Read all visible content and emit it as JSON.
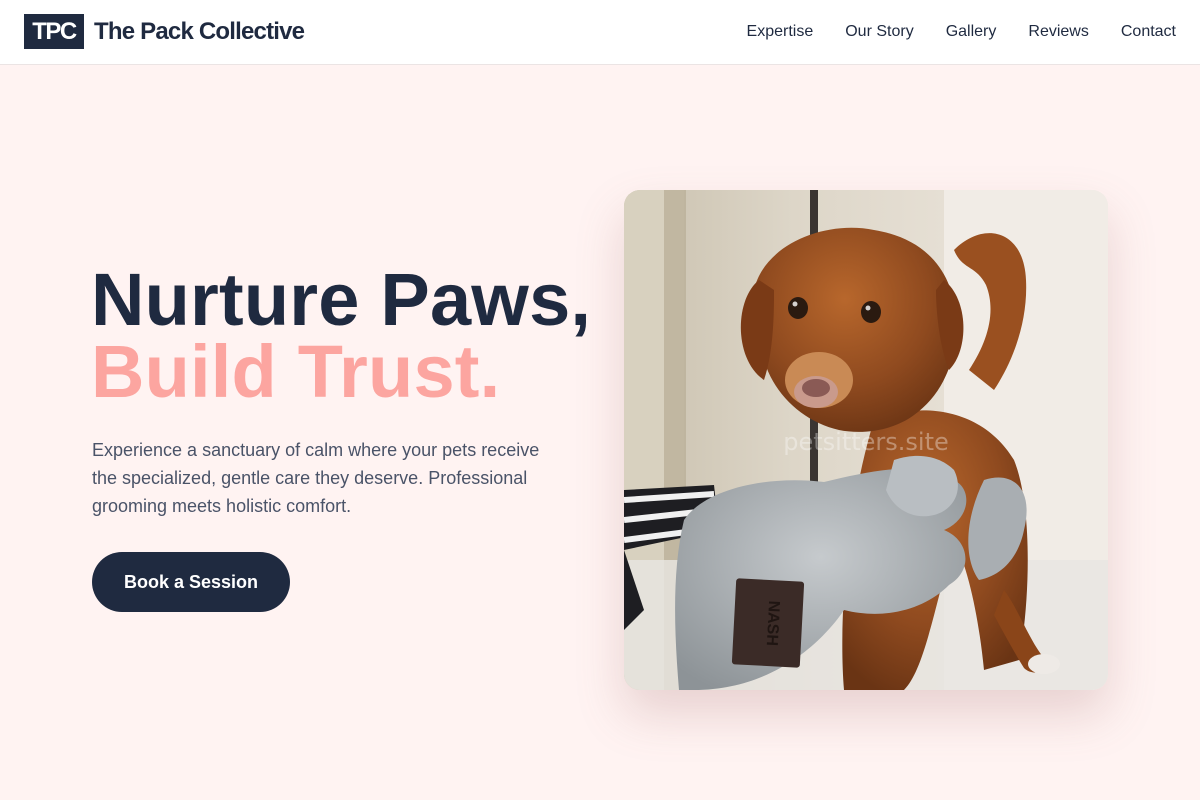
{
  "nav": {
    "logo_text": "TPC",
    "brand_name": "The Pack Collective",
    "links": [
      "Expertise",
      "Our Story",
      "Gallery",
      "Reviews",
      "Contact"
    ]
  },
  "hero": {
    "title_line1": "Nurture Paws,",
    "title_line2": "Build Trust.",
    "description": "Experience a sanctuary of calm where your pets receive the specialized, gentle care they deserve. Professional grooming meets holistic comfort.",
    "cta_label": "Book a Session",
    "image": {
      "watermark": "petsitters.site",
      "towel_tag": "NASH"
    }
  },
  "colors": {
    "primary": "#1f2a40",
    "accent": "#fca5a0",
    "background": "#fff3f2"
  }
}
